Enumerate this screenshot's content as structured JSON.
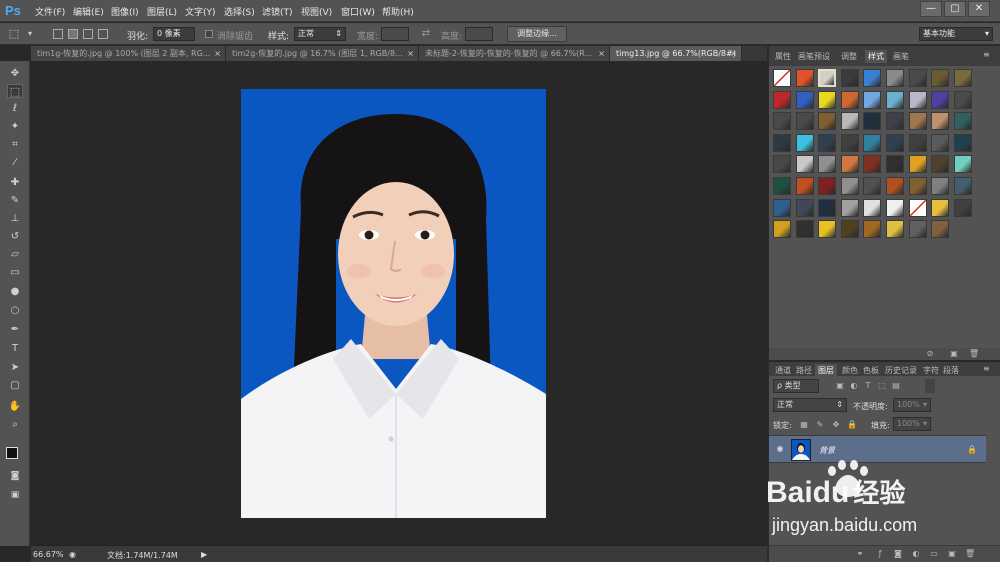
{
  "app": {
    "logo": "Ps"
  },
  "menu": [
    "文件(F)",
    "编辑(E)",
    "图像(I)",
    "图层(L)",
    "文字(Y)",
    "选择(S)",
    "滤镜(T)",
    "视图(V)",
    "窗口(W)",
    "帮助(H)"
  ],
  "window_controls": [
    "—",
    "▢",
    "✕"
  ],
  "options": {
    "feather_label": "羽化:",
    "feather_value": "0 像素",
    "antialias_label": "消除锯齿",
    "style_label": "样式:",
    "style_value": "正常",
    "width_label": "宽度:",
    "height_label": "高度:",
    "refine_button": "调整边缘...",
    "workspace": "基本功能"
  },
  "tabs": [
    {
      "label": "tim1g-恢复的.jpg @ 100% (图层 2 副本, RG...",
      "close": "×",
      "active": false
    },
    {
      "label": "tim2g-恢复的.jpg @ 16.7% (图层 1, RGB/8...",
      "close": "×",
      "active": false
    },
    {
      "label": "未标题-2-恢复的-恢复的-恢复的 @ 66.7%(R...",
      "close": "×",
      "active": false
    },
    {
      "label": "timg13.jpg @ 66.7%(RGB/8#)",
      "close": "×",
      "active": true
    }
  ],
  "status": {
    "zoom": "66.67%",
    "doc": "文档:1.74M/1.74M"
  },
  "styles_panel": {
    "tabs": [
      "属性",
      "画笔预设",
      "调整",
      "样式",
      "画笔"
    ],
    "active_tab": "样式",
    "swatches": [
      [
        "#f2f2f2",
        "#e0542a",
        "#d4d0c0",
        "#3a3a3a",
        "#3a7fd0",
        "#8a8a8a",
        "#4a4a4a",
        "#6a5a30",
        "#7a6a40"
      ],
      [
        "#c02828",
        "#3060c0",
        "#e8d820",
        "#d06830",
        "#70a8e0",
        "#6ab0d0",
        "#b8b8c8",
        "#5040a0",
        "#4a4a4a"
      ],
      [
        "#4a4a4a",
        "#4a4a4a",
        "#806030",
        "#b8b8b8",
        "#203040",
        "#404048",
        "#a07850",
        "#c09070",
        "#306060"
      ],
      [
        "#303840",
        "#40c0e0",
        "#304050",
        "#404040",
        "#3080a0",
        "#304050",
        "#404040",
        "#5a5a5a",
        "#204050"
      ],
      [
        "#484848",
        "#c8c8c8",
        "#909090",
        "#d07840",
        "#803020",
        "#303030",
        "#e0a020",
        "#504030",
        "#70d0c0"
      ],
      [
        "#205040",
        "#c05020",
        "#802020",
        "#909090",
        "#505050",
        "#b05020",
        "#806030",
        "#808080",
        "#406070"
      ],
      [
        "#306090",
        "#404858",
        "#203040",
        "#a0a0a0",
        "#e0e0e0",
        "#f0f0f0",
        "#c0a030",
        "#e8c040",
        "#404040"
      ],
      [
        "#d0a020",
        "#303030",
        "#e8c020",
        "#504020",
        "#a06820",
        "#e0c040",
        "#606060",
        "#806040"
      ]
    ]
  },
  "layers_panel": {
    "tabs": [
      "通道",
      "路径",
      "图层",
      "颜色",
      "色板",
      "历史记录",
      "字符",
      "段落"
    ],
    "active_tab": "图层",
    "kind_filter": "ρ 类型",
    "blend_mode": "正常",
    "opacity_label": "不透明度:",
    "opacity_value": "100%",
    "lock_label": "锁定:",
    "fill_label": "填充:",
    "fill_value": "100%",
    "layer_name": "背景"
  },
  "watermark": {
    "brand": "Baidu",
    "brand_cn": "经验",
    "url": "jingyan.baidu.com"
  },
  "colors": {
    "photo_background": "#0b57c2",
    "layer_selected": "#5c6e8c",
    "ps_blue": "#4ea9f0"
  }
}
